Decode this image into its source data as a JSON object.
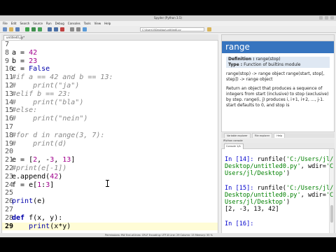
{
  "window": {
    "title": "Spyder (Python 3.5)"
  },
  "menu": [
    "File",
    "Edit",
    "Search",
    "Source",
    "Run",
    "Debug",
    "Consoles",
    "Tools",
    "View",
    "Help"
  ],
  "toolbar": {
    "path": "C:\\Users\\jl\\Desktop\\untitled0.py"
  },
  "editor": {
    "tab_label": "untitled0.py*",
    "lines": [
      {
        "n": "7",
        "segments": []
      },
      {
        "n": "8",
        "segments": [
          {
            "t": "a = ",
            "c": ""
          },
          {
            "t": "42",
            "c": "num"
          }
        ]
      },
      {
        "n": "9",
        "segments": [
          {
            "t": "b = ",
            "c": ""
          },
          {
            "t": "23",
            "c": "num"
          }
        ]
      },
      {
        "n": "10",
        "segments": [
          {
            "t": "c = ",
            "c": ""
          },
          {
            "t": "False",
            "c": "kw"
          }
        ]
      },
      {
        "n": "11",
        "segments": [
          {
            "t": "#if a == 42 and b == 13:",
            "c": "cmt"
          }
        ]
      },
      {
        "n": "12",
        "segments": [
          {
            "t": "#    print(\"ja\")",
            "c": "cmt"
          }
        ]
      },
      {
        "n": "13",
        "segments": [
          {
            "t": "#elif b == 23:",
            "c": "cmt"
          }
        ]
      },
      {
        "n": "14",
        "segments": [
          {
            "t": "#    print(\"bla\")",
            "c": "cmt"
          }
        ]
      },
      {
        "n": "15",
        "segments": [
          {
            "t": "#else:",
            "c": "cmt"
          }
        ]
      },
      {
        "n": "16",
        "segments": [
          {
            "t": "#    print(\"nein\")",
            "c": "cmt"
          }
        ]
      },
      {
        "n": "17",
        "segments": []
      },
      {
        "n": "18",
        "segments": [
          {
            "t": "#for d in range(3, 7):",
            "c": "cmt"
          }
        ]
      },
      {
        "n": "19",
        "segments": [
          {
            "t": "#    print(d)",
            "c": "cmt"
          }
        ]
      },
      {
        "n": "20",
        "segments": []
      },
      {
        "n": "21",
        "segments": [
          {
            "t": "e = [",
            "c": ""
          },
          {
            "t": "2",
            "c": "num"
          },
          {
            "t": ", -",
            "c": ""
          },
          {
            "t": "3",
            "c": "num"
          },
          {
            "t": ", ",
            "c": ""
          },
          {
            "t": "13",
            "c": "num"
          },
          {
            "t": "]",
            "c": ""
          }
        ]
      },
      {
        "n": "22",
        "segments": [
          {
            "t": "#print(e[-1])",
            "c": "cmt"
          }
        ]
      },
      {
        "n": "23",
        "segments": [
          {
            "t": "e.append(",
            "c": ""
          },
          {
            "t": "42",
            "c": "num"
          },
          {
            "t": ")",
            "c": ""
          }
        ]
      },
      {
        "n": "24",
        "segments": [
          {
            "t": "f = e[",
            "c": ""
          },
          {
            "t": "1",
            "c": "num"
          },
          {
            "t": ":",
            "c": ""
          },
          {
            "t": "3",
            "c": "num"
          },
          {
            "t": "]",
            "c": ""
          }
        ]
      },
      {
        "n": "25",
        "segments": []
      },
      {
        "n": "26",
        "segments": [
          {
            "t": "print",
            "c": "kw"
          },
          {
            "t": "(e)",
            "c": ""
          }
        ]
      },
      {
        "n": "27",
        "segments": []
      },
      {
        "n": "28",
        "segments": [
          {
            "t": "def",
            "c": "def-kw"
          },
          {
            "t": " f(x, y):",
            "c": ""
          }
        ]
      },
      {
        "n": "29",
        "segments": [
          {
            "t": "    ",
            "c": ""
          },
          {
            "t": "print",
            "c": "kw"
          },
          {
            "t": "(x*y)",
            "c": ""
          }
        ],
        "current": true
      }
    ]
  },
  "help": {
    "object": "range",
    "definition_label": "Definition :",
    "definition_value": "range(stop)",
    "type_label": "Type :",
    "type_value": "Function of builtins module",
    "para1": "range(stop) -> range object range(start, stop[, step]) -> range object",
    "para2": "Return an object that produces a sequence of integers from start (inclusive) to stop (exclusive) by step. range(i, j) produces i, i+1, i+2, ..., j-1. start defaults to 0, and stop is"
  },
  "pane_tabs": [
    "Variable explorer",
    "File explorer",
    "Help"
  ],
  "console": {
    "label": "IPython console",
    "tab": "Console 1/A",
    "lines": [
      [
        {
          "t": "In [",
          "c": "prompt"
        },
        {
          "t": "14",
          "c": "prompt"
        },
        {
          "t": "]: ",
          "c": "prompt"
        },
        {
          "t": "runfile(",
          "c": ""
        },
        {
          "t": "'C:/Users/jl/",
          "c": "str"
        }
      ],
      [
        {
          "t": "Desktop/untitled0.py'",
          "c": "str"
        },
        {
          "t": ", wdir=",
          "c": ""
        },
        {
          "t": "'C:/",
          "c": "str"
        }
      ],
      [
        {
          "t": "Users/jl/Desktop'",
          "c": "str"
        },
        {
          "t": ")",
          "c": ""
        }
      ],
      [],
      [
        {
          "t": "In [",
          "c": "prompt"
        },
        {
          "t": "15",
          "c": "prompt"
        },
        {
          "t": "]: ",
          "c": "prompt"
        },
        {
          "t": "runfile(",
          "c": ""
        },
        {
          "t": "'C:/Users/jl/",
          "c": "str"
        }
      ],
      [
        {
          "t": "Desktop/untitled0.py'",
          "c": "str"
        },
        {
          "t": ", wdir=",
          "c": ""
        },
        {
          "t": "'C:/",
          "c": "str"
        }
      ],
      [
        {
          "t": "Users/jl/Desktop'",
          "c": "str"
        },
        {
          "t": ")",
          "c": ""
        }
      ],
      [
        {
          "t": "[2, -3, 13, 42]",
          "c": ""
        }
      ],
      [],
      [
        {
          "t": "In [",
          "c": "prompt"
        },
        {
          "t": "16",
          "c": "prompt"
        },
        {
          "t": "]:",
          "c": "prompt"
        }
      ]
    ]
  },
  "status": "Permissions: RW   End-of-lines: CRLF   Encoding: UTF-8   Line: 29   Column: 15   Memory: 55 %"
}
